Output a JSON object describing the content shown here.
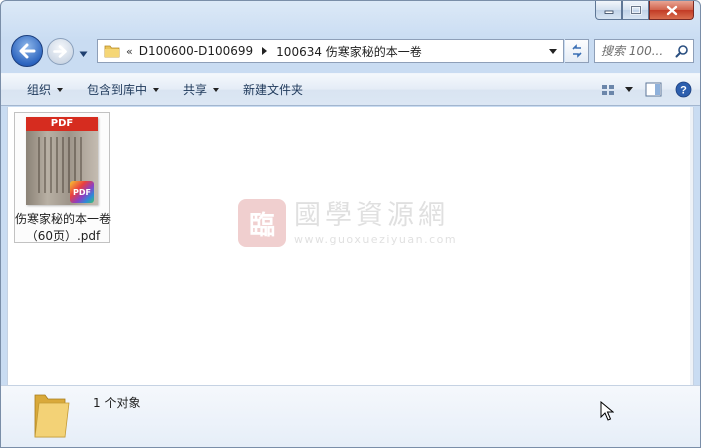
{
  "window": {
    "buttons": {
      "minimize": "minimize",
      "maximize": "maximize",
      "close": "close"
    }
  },
  "navigation": {
    "path_prefix": "«",
    "breadcrumbs": [
      "D100600-D100699",
      "100634 伤寒家秘的本一卷"
    ],
    "search_placeholder": "搜索 100...",
    "icons": [
      "back-arrow-icon",
      "forward-arrow-icon",
      "folder-icon",
      "refresh-icon",
      "search-icon"
    ]
  },
  "toolbar": {
    "organize": "组织",
    "include_in_library": "包含到库中",
    "share": "共享",
    "new_folder": "新建文件夹"
  },
  "files": [
    {
      "name": "伤寒家秘的本一卷（60页）.pdf",
      "thumb_band": "PDF",
      "badge": "PDF"
    }
  ],
  "watermark": {
    "seal": "臨",
    "title": "國學資源網",
    "url": "www.guoxueziyuan.com"
  },
  "details": {
    "count_text": "1 个对象"
  },
  "colors": {
    "accent": "#2e66c0",
    "pdf_red": "#d62c1f",
    "frame": "#c9dcf2"
  }
}
